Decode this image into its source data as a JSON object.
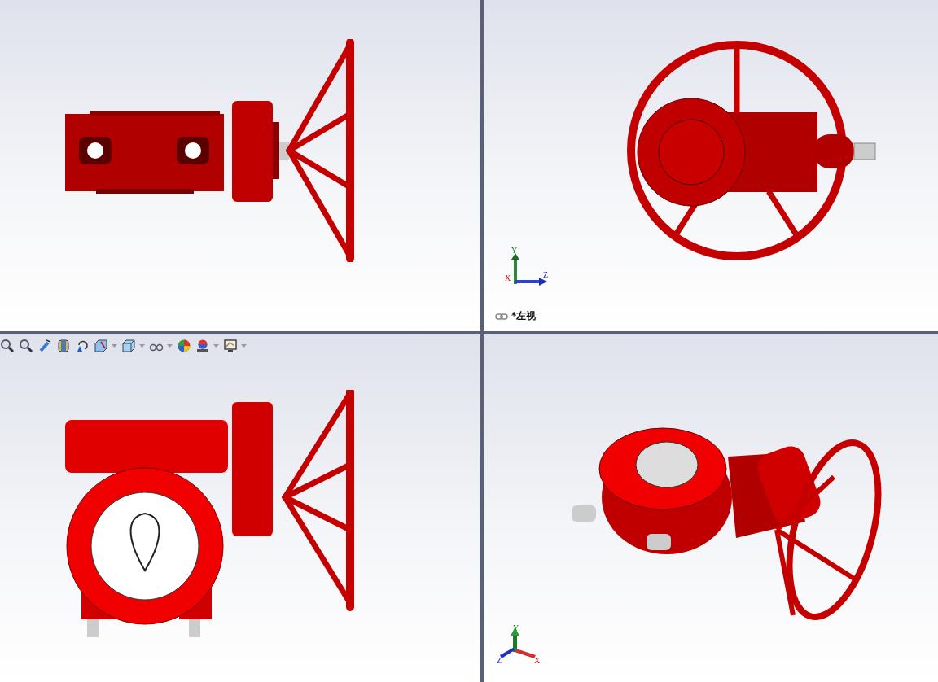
{
  "viewports": [
    {
      "kind": "side"
    },
    {
      "kind": "wheel",
      "triad": {
        "kind": "planar",
        "axes": [
          {
            "label": "Y"
          },
          {
            "label": "X"
          },
          {
            "label": "Z"
          }
        ]
      },
      "view_label": "*左视"
    },
    {
      "kind": "front",
      "toolbar": [
        {
          "kind": "magnifier"
        },
        {
          "kind": "magnifier"
        },
        {
          "kind": "wand"
        },
        {
          "kind": "cylinder"
        },
        {
          "kind": "rotate"
        },
        {
          "kind": "section"
        },
        {
          "kind": "caret"
        },
        {
          "kind": "cube"
        },
        {
          "kind": "caret"
        },
        {
          "kind": "glasses"
        },
        {
          "kind": "caret"
        },
        {
          "kind": "ball"
        },
        {
          "kind": "scene"
        },
        {
          "kind": "caret"
        },
        {
          "kind": "monitor"
        },
        {
          "kind": "caret"
        }
      ]
    },
    {
      "kind": "iso",
      "triad": {
        "kind": "iso",
        "axes": [
          {
            "label": "Y"
          },
          {
            "label": "Z"
          },
          {
            "label": "X"
          }
        ]
      }
    }
  ]
}
